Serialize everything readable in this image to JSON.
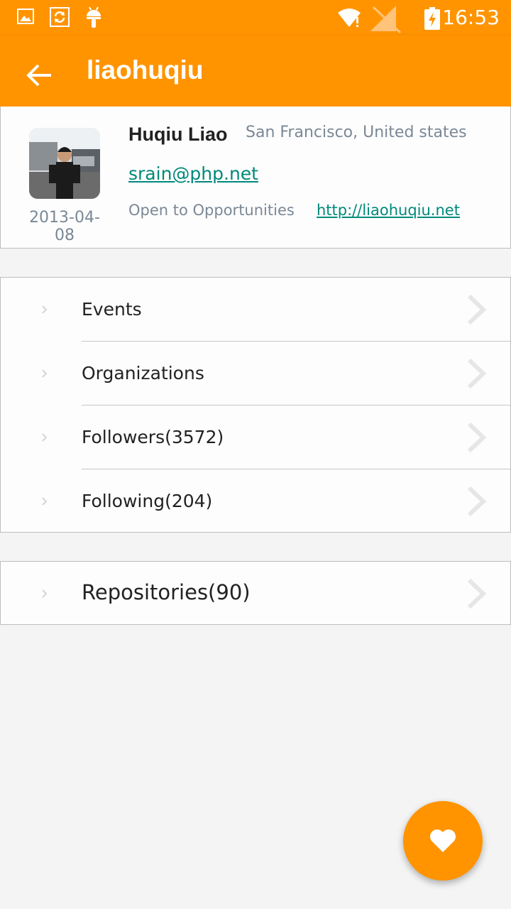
{
  "status_bar": {
    "time": "16:53",
    "icons": [
      "image-icon",
      "sync-icon",
      "android-icon",
      "wifi-icon",
      "no-sim-icon",
      "battery-charging-icon"
    ]
  },
  "toolbar": {
    "title": "liaohuqiu",
    "back_icon": "arrow-back-icon"
  },
  "profile": {
    "name": "Huqiu Liao",
    "location": "San Francisco, United states",
    "email": "srain@php.net",
    "hireable": "Open to Opportunities",
    "blog": "http://liaohuqiu.net",
    "join_date": "2013-04-08"
  },
  "menu": {
    "items": [
      {
        "label": "Events"
      },
      {
        "label": "Organizations"
      },
      {
        "label": "Followers(3572)"
      },
      {
        "label": "Following(204)"
      }
    ]
  },
  "repos": {
    "label": "Repositories(90)"
  },
  "fab": {
    "icon": "heart-icon"
  },
  "colors": {
    "accent": "#ff9400",
    "link": "#00897b",
    "secondary_text": "#7a8896"
  }
}
